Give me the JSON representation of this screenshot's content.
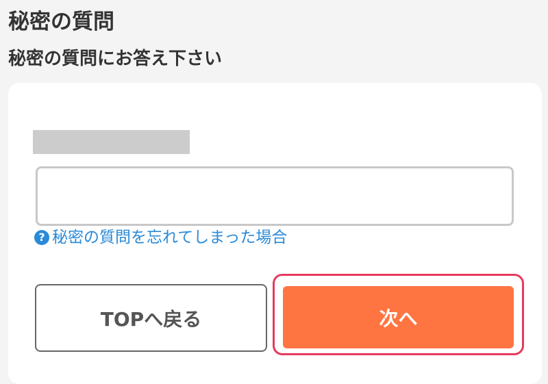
{
  "header": {
    "title": "秘密の質問",
    "subtitle": "秘密の質問にお答え下さい"
  },
  "form": {
    "answer_value": "",
    "help_icon": "question-circle-icon",
    "help_icon_glyph": "?",
    "forgot_link": "秘密の質問を忘れてしまった場合"
  },
  "buttons": {
    "back_to_top": "TOPへ戻る",
    "next": "次へ"
  },
  "colors": {
    "background": "#f4f4f4",
    "card": "#ffffff",
    "link": "#2a8ad8",
    "primary_button": "#ff7542",
    "focus_ring": "#e53a5e",
    "redacted_question": "#cccccc"
  }
}
